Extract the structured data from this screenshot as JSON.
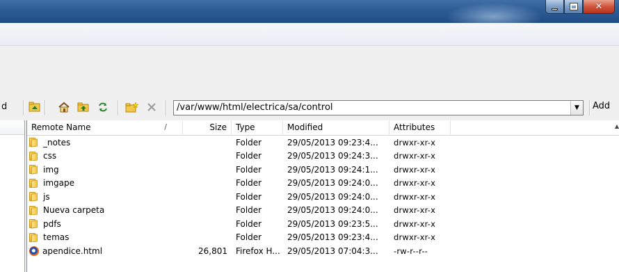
{
  "toolbar": {
    "cut_label": "d",
    "path": "/var/www/html/electrica/sa/control",
    "add_label": "Add"
  },
  "columns": {
    "name": "Remote Name",
    "sort_indicator": "/",
    "size": "Size",
    "type": "Type",
    "modified": "Modified",
    "attributes": "Attributes"
  },
  "rows": [
    {
      "name": "_notes",
      "size": "",
      "type": "Folder",
      "modified": "29/05/2013 09:23:4...",
      "attributes": "drwxr-xr-x",
      "icon": "folder-icon"
    },
    {
      "name": "css",
      "size": "",
      "type": "Folder",
      "modified": "29/05/2013 09:24:3...",
      "attributes": "drwxr-xr-x",
      "icon": "folder-icon"
    },
    {
      "name": "img",
      "size": "",
      "type": "Folder",
      "modified": "29/05/2013 09:24:1...",
      "attributes": "drwxr-xr-x",
      "icon": "folder-icon"
    },
    {
      "name": "imgape",
      "size": "",
      "type": "Folder",
      "modified": "29/05/2013 09:24:0...",
      "attributes": "drwxr-xr-x",
      "icon": "folder-icon"
    },
    {
      "name": "js",
      "size": "",
      "type": "Folder",
      "modified": "29/05/2013 09:24:0...",
      "attributes": "drwxr-xr-x",
      "icon": "folder-icon"
    },
    {
      "name": "Nueva carpeta",
      "size": "",
      "type": "Folder",
      "modified": "29/05/2013 09:24:0...",
      "attributes": "drwxr-xr-x",
      "icon": "folder-icon"
    },
    {
      "name": "pdfs",
      "size": "",
      "type": "Folder",
      "modified": "29/05/2013 09:23:5...",
      "attributes": "drwxr-xr-x",
      "icon": "folder-icon"
    },
    {
      "name": "temas",
      "size": "",
      "type": "Folder",
      "modified": "29/05/2013 09:23:4...",
      "attributes": "drwxr-xr-x",
      "icon": "folder-icon"
    },
    {
      "name": "apendice.html",
      "size": "26,801",
      "type": "Firefox H...",
      "modified": "29/05/2013 07:04:3...",
      "attributes": "-rw-r--r--",
      "icon": "firefox-html-icon"
    }
  ]
}
